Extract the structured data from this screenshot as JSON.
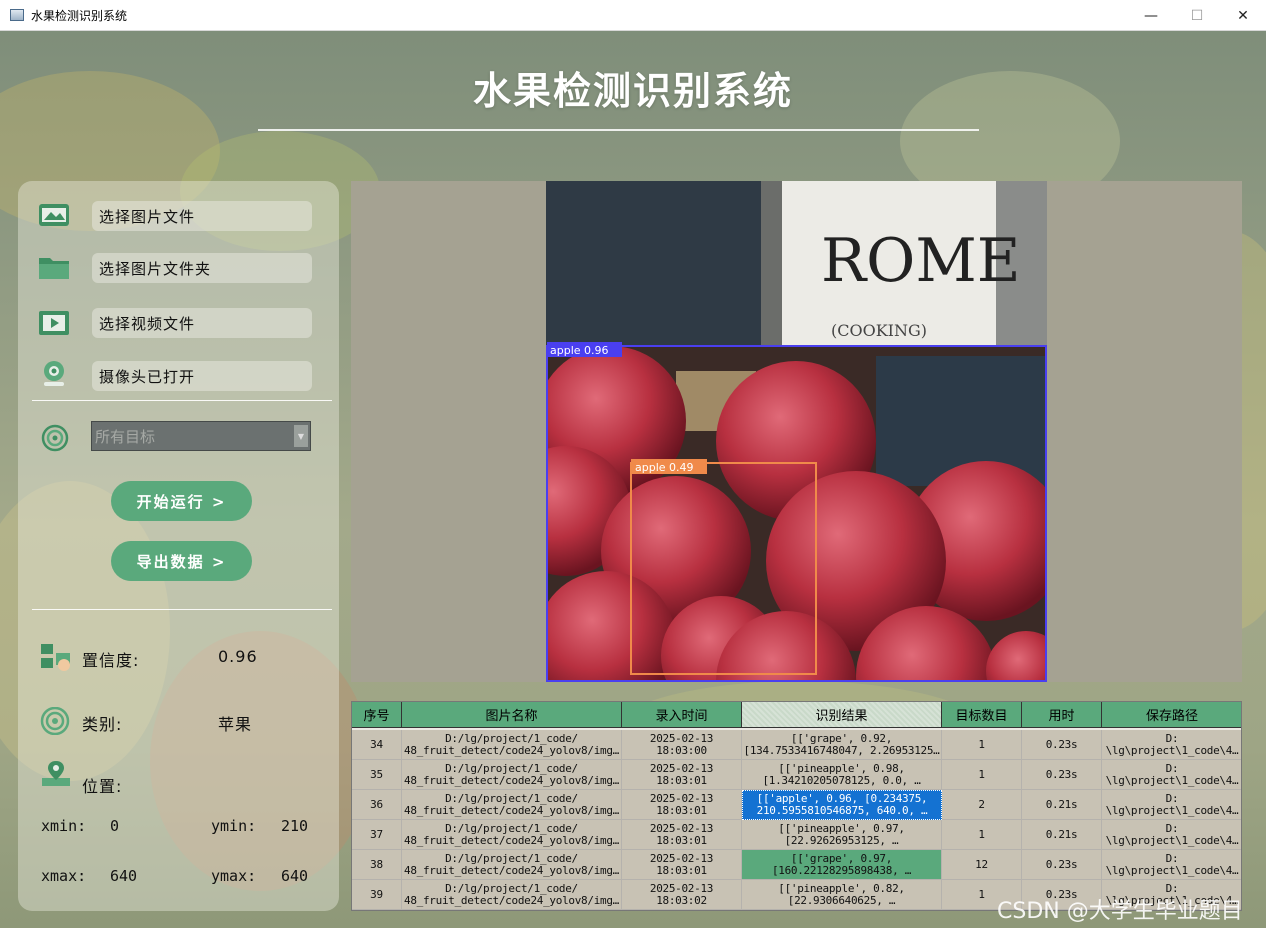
{
  "window": {
    "title": "水果检测识别系统"
  },
  "header": {
    "title": "水果检测识别系统"
  },
  "sidebar": {
    "items": [
      {
        "label": "选择图片文件",
        "icon": "image-folder-icon"
      },
      {
        "label": "选择图片文件夹",
        "icon": "folder-icon"
      },
      {
        "label": "选择视频文件",
        "icon": "video-file-icon"
      },
      {
        "label": "摄像头已打开",
        "icon": "camera-icon"
      }
    ],
    "target_select": {
      "value": "所有目标",
      "icon": "target-icon"
    },
    "run_button": "开始运行 >",
    "export_button": "导出数据 >"
  },
  "info": {
    "confidence_label": "置信度:",
    "confidence_value": "0.96",
    "class_label": "类别:",
    "class_value": "苹果",
    "position_label": "位置:",
    "xmin_label": "xmin:",
    "xmin_value": "0",
    "ymin_label": "ymin:",
    "ymin_value": "210",
    "xmax_label": "xmax:",
    "xmax_value": "640",
    "ymax_label": "ymax:",
    "ymax_value": "640"
  },
  "image": {
    "sign_text": "ROME",
    "sign_sub": "(COOKING)",
    "detections": [
      {
        "label": "apple 0.96",
        "color": "#4a3ff0"
      },
      {
        "label": "apple 0.49",
        "color": "#f08a4a"
      }
    ]
  },
  "table": {
    "headers": [
      "序号",
      "图片名称",
      "录入时间",
      "识别结果",
      "目标数目",
      "用时",
      "保存路径"
    ],
    "rows": [
      {
        "id": "34",
        "name": "D:/lg/project/1_code/\n48_fruit_detect/code24_yolov8/img…",
        "time": "2025-02-13\n18:03:00",
        "result": "[['grape', 0.92,\n[134.7533416748047, 2.26953125…",
        "count": "1",
        "duration": "0.23s",
        "path": "D:\n\\lg\\project\\1_code\\4…"
      },
      {
        "id": "35",
        "name": "D:/lg/project/1_code/\n48_fruit_detect/code24_yolov8/img…",
        "time": "2025-02-13\n18:03:01",
        "result": "[['pineapple', 0.98,\n[1.34210205078125, 0.0, …",
        "count": "1",
        "duration": "0.23s",
        "path": "D:\n\\lg\\project\\1_code\\4…"
      },
      {
        "id": "36",
        "name": "D:/lg/project/1_code/\n48_fruit_detect/code24_yolov8/img…",
        "time": "2025-02-13\n18:03:01",
        "result": "[['apple', 0.96, [0.234375,\n210.5955810546875, 640.0, …",
        "count": "2",
        "duration": "0.21s",
        "path": "D:\n\\lg\\project\\1_code\\4…"
      },
      {
        "id": "37",
        "name": "D:/lg/project/1_code/\n48_fruit_detect/code24_yolov8/img…",
        "time": "2025-02-13\n18:03:01",
        "result": "[['pineapple', 0.97,\n[22.92626953125, …",
        "count": "1",
        "duration": "0.21s",
        "path": "D:\n\\lg\\project\\1_code\\4…"
      },
      {
        "id": "38",
        "name": "D:/lg/project/1_code/\n48_fruit_detect/code24_yolov8/img…",
        "time": "2025-02-13\n18:03:01",
        "result": "[['grape', 0.97,\n[160.22128295898438, …",
        "count": "12",
        "duration": "0.23s",
        "path": "D:\n\\lg\\project\\1_code\\4…"
      },
      {
        "id": "39",
        "name": "D:/lg/project/1_code/\n48_fruit_detect/code24_yolov8/img…",
        "time": "2025-02-13\n18:03:02",
        "result": "[['pineapple', 0.82,\n[22.9306640625, …",
        "count": "1",
        "duration": "0.23s",
        "path": "D:\n\\lg\\project\\1_code\\4…"
      }
    ]
  },
  "watermark": "CSDN @大学生毕业题目",
  "colors": {
    "accent": "#5aa97c",
    "selection": "#1472d2"
  }
}
